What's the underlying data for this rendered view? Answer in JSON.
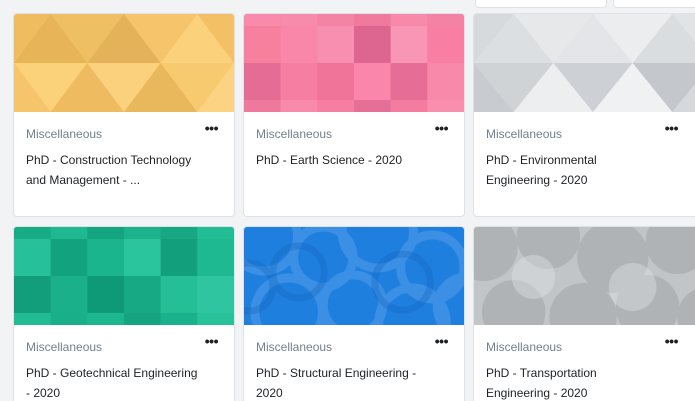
{
  "courses": [
    {
      "category": "Miscellaneous",
      "title": "PhD - Construction Technology and Management - ...",
      "menu": "•••",
      "pattern": "triangles",
      "color": "#f9c86a"
    },
    {
      "category": "Miscellaneous",
      "title": "PhD - Earth Science - 2020",
      "menu": "•••",
      "pattern": "squares",
      "color": "#f87ba1"
    },
    {
      "category": "Miscellaneous",
      "title": "PhD - Environmental Engineering - 2020",
      "menu": "•••",
      "pattern": "triangles",
      "color": "#e1e4e6"
    },
    {
      "category": "Miscellaneous",
      "title": "PhD - Geotechnical Engineering - 2020",
      "menu": "•••",
      "pattern": "squares",
      "color": "#1bb58e"
    },
    {
      "category": "Miscellaneous",
      "title": "PhD - Structural Engineering - 2020",
      "menu": "•••",
      "pattern": "circles",
      "color": "#1f7fdf"
    },
    {
      "category": "Miscellaneous",
      "title": "PhD - Transportation Engineering - 2020",
      "menu": "•••",
      "pattern": "circles",
      "color": "#c2c5c8"
    }
  ]
}
